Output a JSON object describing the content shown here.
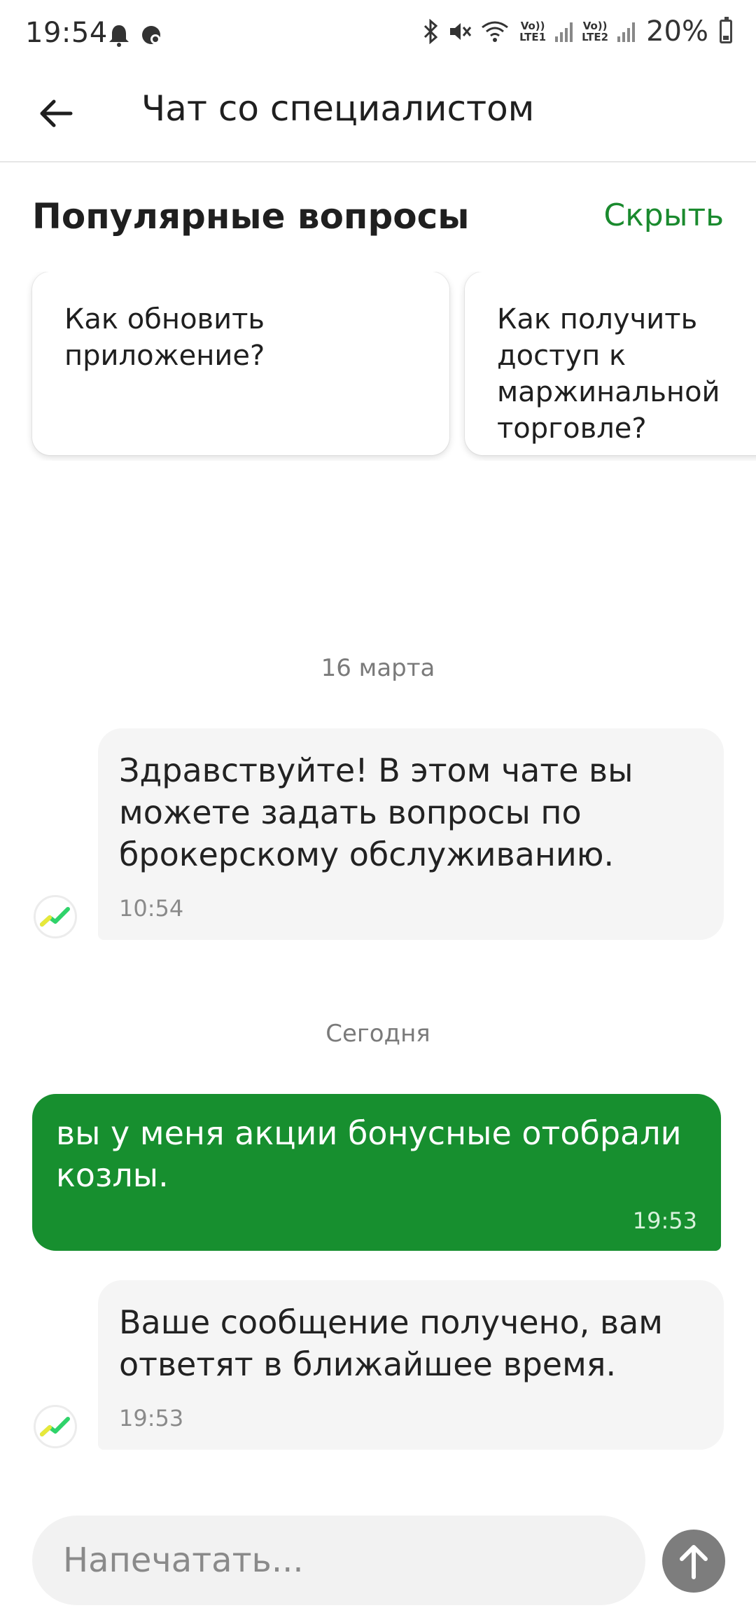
{
  "status_bar": {
    "time": "19:54",
    "sim1_label": "Vo)) LTE1",
    "sim2_label": "Vo)) LTE2",
    "battery_percent": "20%",
    "icons": [
      "notification-icon",
      "notification-icon",
      "bluetooth-icon",
      "mute-icon",
      "wifi-icon",
      "signal-icon",
      "battery-icon"
    ]
  },
  "app_bar": {
    "title": "Чат со специалистом"
  },
  "popular_questions": {
    "title": "Популярные вопросы",
    "hide_label": "Скрыть",
    "items": [
      {
        "text": "Как обновить приложение?"
      },
      {
        "text": "Как получить доступ к маржинальной торговле?"
      }
    ]
  },
  "chat": {
    "date_1": "16 марта",
    "date_2": "Сегодня",
    "messages": [
      {
        "from": "bot",
        "text": "Здравствуйте! В этом чате вы можете задать вопросы по брокерскому обслуживанию.",
        "time": "10:54"
      },
      {
        "from": "user",
        "text": "вы у меня акции бонусные отобрали козлы.",
        "time": "19:53"
      },
      {
        "from": "bot",
        "text": "Ваше сообщение получено, вам ответят в ближайшее время.",
        "time": "19:53"
      }
    ]
  },
  "composer": {
    "placeholder": "Напечатать...",
    "value": ""
  },
  "colors": {
    "accent": "#178f2f",
    "link": "#1a8a2e",
    "incoming_bubble": "#f5f5f5",
    "send_button": "#7d7d7d"
  }
}
